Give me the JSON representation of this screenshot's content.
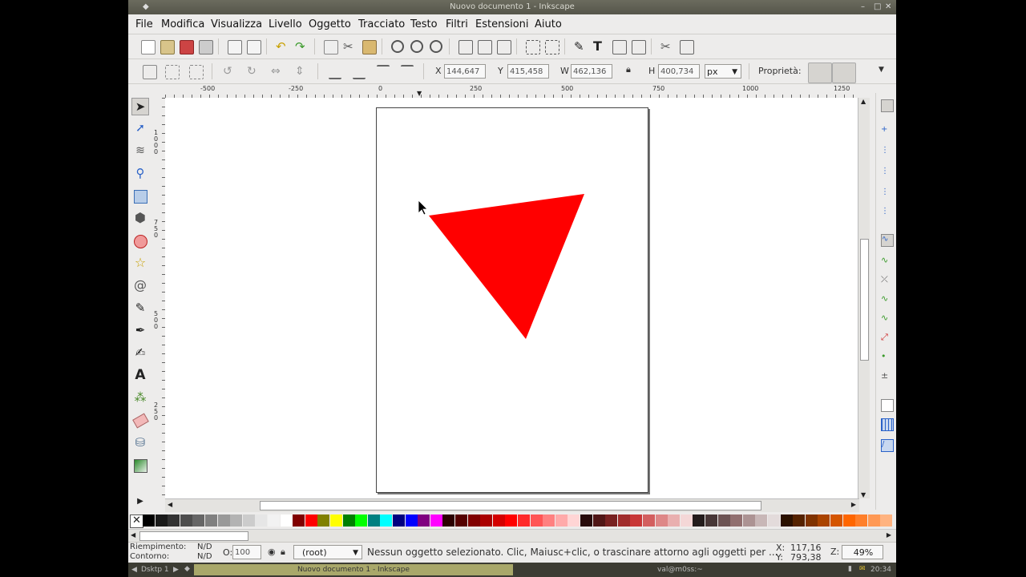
{
  "window": {
    "title": "Nuovo documento 1 - Inkscape"
  },
  "menu": [
    "File",
    "Modifica",
    "Visualizza",
    "Livello",
    "Oggetto",
    "Tracciato",
    "Testo",
    "Filtri",
    "Estensioni",
    "Aiuto"
  ],
  "toolbar2": {
    "x_label": "X",
    "x_value": "144,647",
    "y_label": "Y",
    "y_value": "415,458",
    "w_label": "W",
    "w_value": "462,136",
    "h_label": "H",
    "h_value": "400,734",
    "unit": "px",
    "props_label": "Proprietà:"
  },
  "ruler": {
    "h_ticks": [
      "-500",
      "-250",
      "0",
      "250",
      "500",
      "750",
      "1000",
      "1250"
    ],
    "v_ticks": [
      "1000",
      "750",
      "500",
      "250"
    ]
  },
  "canvas": {
    "shape_color": "#ff0000"
  },
  "palette": {
    "colors": [
      "#000000",
      "#1a1a1a",
      "#333333",
      "#4d4d4d",
      "#666666",
      "#808080",
      "#999999",
      "#b3b3b3",
      "#cccccc",
      "#e6e6e6",
      "#f2f2f2",
      "#ffffff",
      "#800000",
      "#ff0000",
      "#808000",
      "#ffff00",
      "#008000",
      "#00ff00",
      "#008080",
      "#00ffff",
      "#000080",
      "#0000ff",
      "#800080",
      "#ff00ff",
      "#2b0000",
      "#550000",
      "#800000",
      "#aa0000",
      "#d40000",
      "#ff0000",
      "#ff2a2a",
      "#ff5555",
      "#ff8080",
      "#ffaaaa",
      "#ffd5d5",
      "#280b0b",
      "#501616",
      "#782121",
      "#a02c2c",
      "#c83737",
      "#d35f5f",
      "#de8787",
      "#e9afaf",
      "#f4d7d7",
      "#241c1c",
      "#483737",
      "#6c5353",
      "#916f6f",
      "#ac9393",
      "#c8b7b7",
      "#e3dbdb",
      "#2b1100",
      "#552200",
      "#803300",
      "#aa4400",
      "#d45500",
      "#ff6600",
      "#ff7f2a",
      "#ff9955",
      "#ffb380"
    ]
  },
  "status": {
    "fill_label": "Riempimento:",
    "fill_value": "N/D",
    "stroke_label": "Contorno:",
    "stroke_value": "N/D",
    "opacity_label": "O:",
    "opacity_value": "100",
    "layer": "(root)",
    "message": "Nessun oggetto selezionato. Clic, Maiusc+clic, o trascinare attorno agli oggetti per ...",
    "x_label": "X:",
    "x_value": "117,16",
    "y_label": "Y:",
    "y_value": "793,38",
    "zoom_label": "Z:",
    "zoom_value": "49%"
  },
  "taskbar": {
    "desktop": "Dsktp 1",
    "task": "Nuovo documento 1 - Inkscape",
    "user": "val@m0ss:~",
    "clock": "20:34"
  }
}
